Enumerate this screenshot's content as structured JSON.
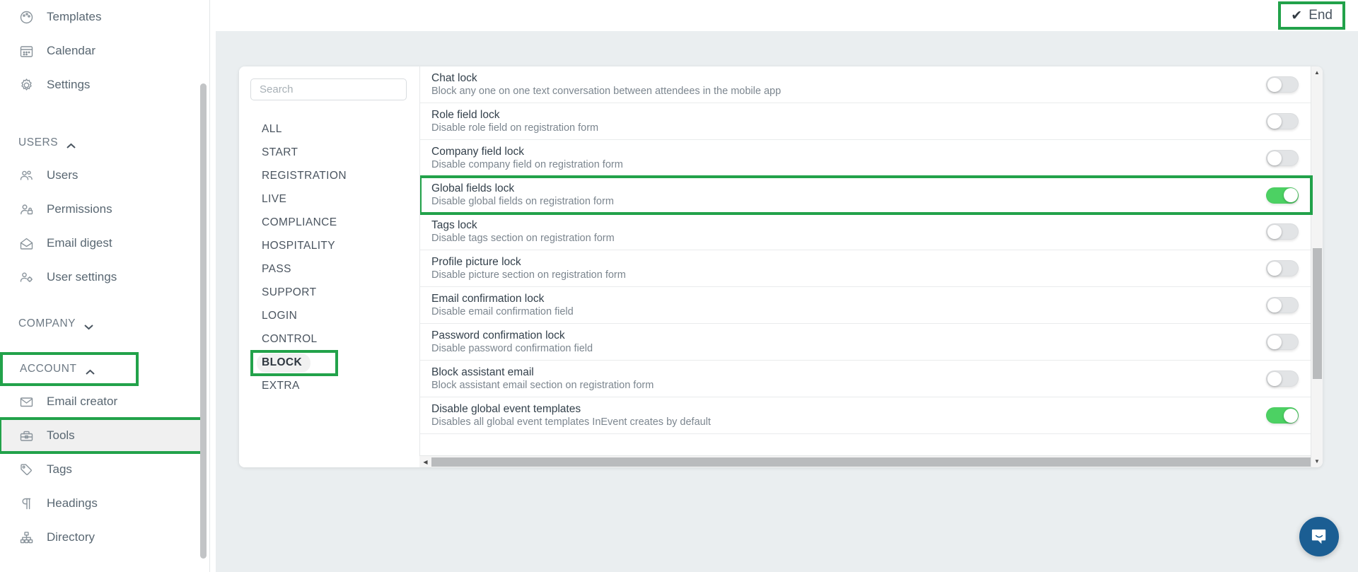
{
  "sidebar": {
    "top_items": [
      {
        "label": "Templates",
        "icon": "palette-icon"
      },
      {
        "label": "Calendar",
        "icon": "calendar-icon"
      },
      {
        "label": "Settings",
        "icon": "gear-icon"
      }
    ],
    "users_section": {
      "label": "USERS",
      "chevron": "chevron-up-icon"
    },
    "users_items": [
      {
        "label": "Users",
        "icon": "users-icon"
      },
      {
        "label": "Permissions",
        "icon": "user-lock-icon"
      },
      {
        "label": "Email digest",
        "icon": "envelope-open-icon"
      },
      {
        "label": "User settings",
        "icon": "user-gear-icon"
      }
    ],
    "company_section": {
      "label": "COMPANY",
      "chevron": "chevron-down-icon"
    },
    "account_section": {
      "label": "ACCOUNT",
      "chevron": "chevron-up-icon",
      "highlighted": true
    },
    "account_items": [
      {
        "label": "Email creator",
        "icon": "envelope-icon",
        "active": false
      },
      {
        "label": "Tools",
        "icon": "toolbox-icon",
        "active": true,
        "highlighted": true
      },
      {
        "label": "Tags",
        "icon": "tag-icon",
        "active": false
      },
      {
        "label": "Headings",
        "icon": "paragraph-icon",
        "active": false
      },
      {
        "label": "Directory",
        "icon": "sitemap-icon",
        "active": false
      }
    ]
  },
  "topbar": {
    "end_label": "End",
    "end_icon": "check-icon"
  },
  "panel": {
    "search": {
      "placeholder": "Search",
      "value": ""
    },
    "categories": [
      {
        "label": "ALL",
        "selected": false
      },
      {
        "label": "START",
        "selected": false
      },
      {
        "label": "REGISTRATION",
        "selected": false
      },
      {
        "label": "LIVE",
        "selected": false
      },
      {
        "label": "COMPLIANCE",
        "selected": false
      },
      {
        "label": "HOSPITALITY",
        "selected": false
      },
      {
        "label": "PASS",
        "selected": false
      },
      {
        "label": "SUPPORT",
        "selected": false
      },
      {
        "label": "LOGIN",
        "selected": false
      },
      {
        "label": "CONTROL",
        "selected": false
      },
      {
        "label": "BLOCK",
        "selected": true,
        "highlighted": true
      },
      {
        "label": "EXTRA",
        "selected": false
      }
    ],
    "settings": [
      {
        "title": "Chat lock",
        "desc": "Block any one on one text conversation between attendees in the mobile app",
        "on": false
      },
      {
        "title": "Role field lock",
        "desc": "Disable role field on registration form",
        "on": false
      },
      {
        "title": "Company field lock",
        "desc": "Disable company field on registration form",
        "on": false
      },
      {
        "title": "Global fields lock",
        "desc": "Disable global fields on registration form",
        "on": true,
        "highlighted": true
      },
      {
        "title": "Tags lock",
        "desc": "Disable tags section on registration form",
        "on": false
      },
      {
        "title": "Profile picture lock",
        "desc": "Disable picture section on registration form",
        "on": false
      },
      {
        "title": "Email confirmation lock",
        "desc": "Disable email confirmation field",
        "on": false
      },
      {
        "title": "Password confirmation lock",
        "desc": "Disable password confirmation field",
        "on": false
      },
      {
        "title": "Block assistant email",
        "desc": "Block assistant email section on registration form",
        "on": false
      },
      {
        "title": "Disable global event templates",
        "desc": "Disables all global event templates InEvent creates by default",
        "on": true
      }
    ]
  },
  "colors": {
    "highlight": "#22a24a",
    "toggle_on": "#4cd163",
    "intercom": "#1b5e93"
  },
  "intercom": {
    "icon": "chat-bubble-icon"
  }
}
